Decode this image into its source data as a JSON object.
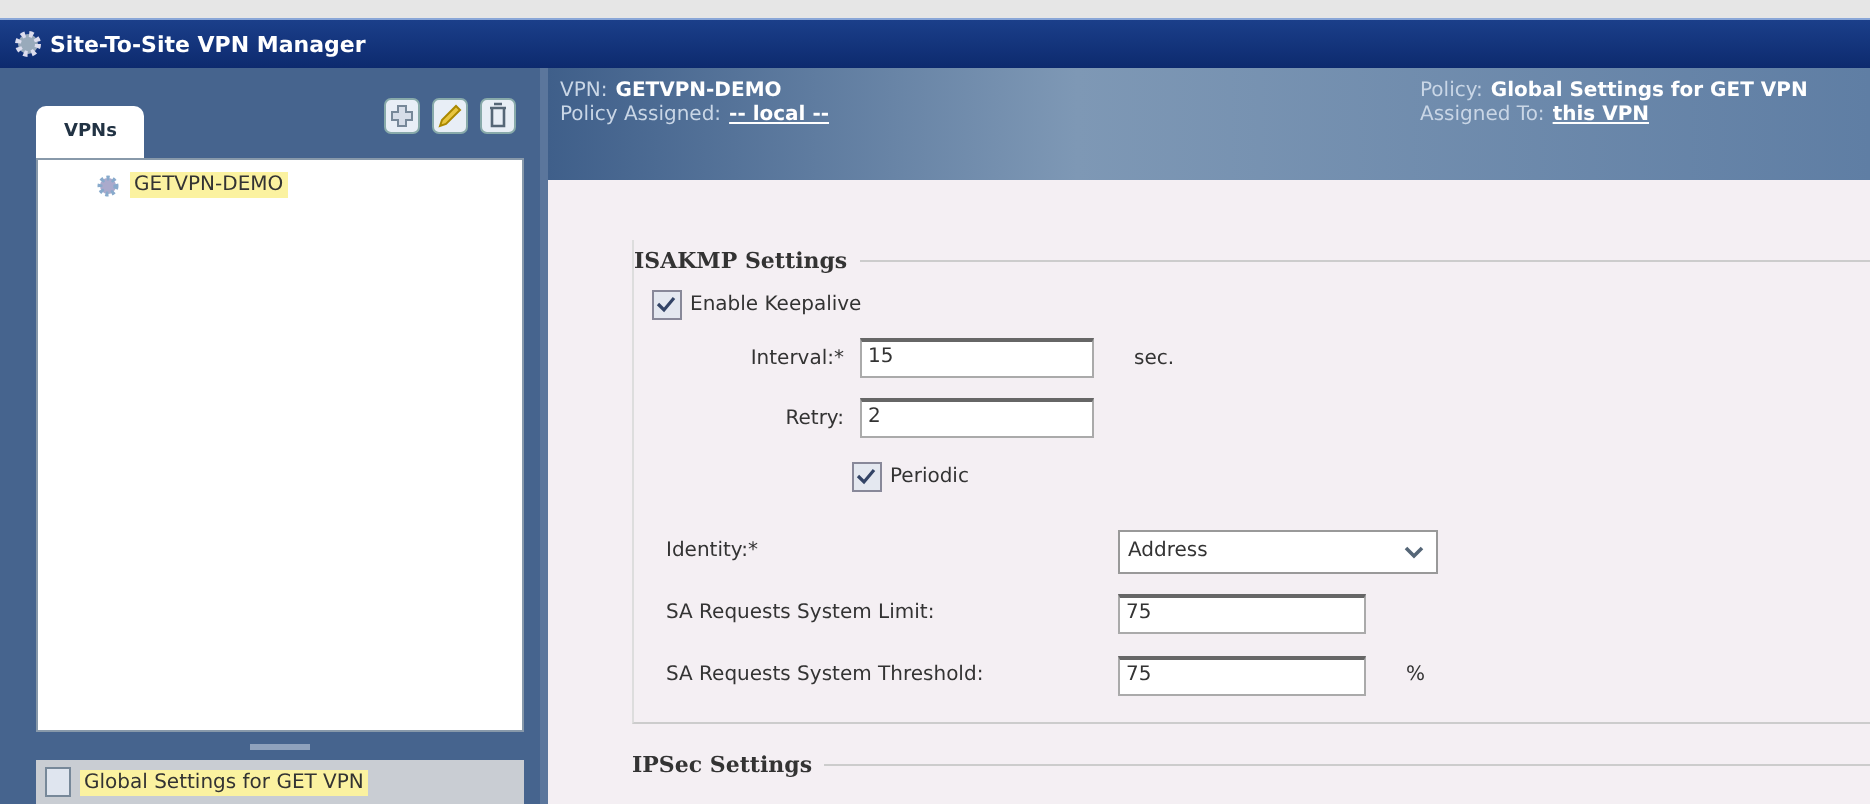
{
  "window": {
    "title": "Site-To-Site VPN Manager"
  },
  "sidebar": {
    "tabs": [
      {
        "label": "VPNs",
        "selected": true
      }
    ],
    "vpns": [
      {
        "name": "GETVPN-DEMO",
        "selected": true
      }
    ],
    "policies": [
      {
        "name": "Global Settings for GET VPN",
        "selected": true
      }
    ]
  },
  "header": {
    "vpn_label": "VPN:",
    "vpn": "GETVPN-DEMO",
    "policy_assigned_label": "Policy Assigned:",
    "policy_assigned": "-- local --",
    "policy_label": "Policy:",
    "policy": "Global Settings for GET VPN",
    "assigned_to_label": "Assigned To:",
    "assigned_to": "this VPN"
  },
  "isakmp": {
    "title": "ISAKMP Settings",
    "enable_keepalive": {
      "label": "Enable Keepalive",
      "checked": true
    },
    "interval": {
      "label": "Interval:*",
      "value": "15",
      "unit": "sec."
    },
    "retry": {
      "label": "Retry:",
      "value": "2"
    },
    "periodic": {
      "label": "Periodic",
      "checked": true
    },
    "identity": {
      "label": "Identity:*",
      "value": "Address"
    },
    "sa_limit": {
      "label": "SA Requests System Limit:",
      "value": "75"
    },
    "sa_threshold": {
      "label": "SA Requests System Threshold:",
      "value": "75",
      "unit": "%"
    }
  },
  "ipsec": {
    "title": "IPSec Settings"
  }
}
